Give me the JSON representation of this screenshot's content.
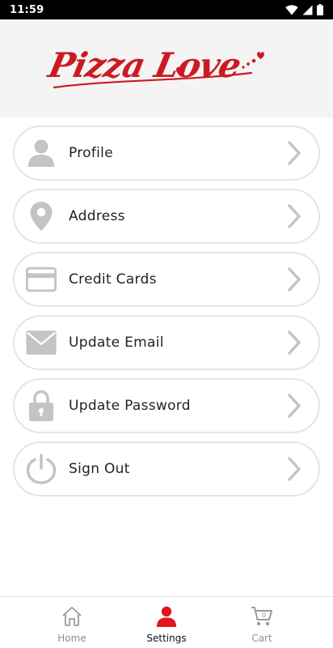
{
  "status_bar": {
    "time": "11:59"
  },
  "header": {
    "logo_text": "Pizza Love"
  },
  "menu": {
    "items": [
      {
        "label": "Profile",
        "icon": "person-icon"
      },
      {
        "label": "Address",
        "icon": "location-pin-icon"
      },
      {
        "label": "Credit Cards",
        "icon": "credit-card-icon"
      },
      {
        "label": "Update Email",
        "icon": "envelope-icon"
      },
      {
        "label": "Update Password",
        "icon": "padlock-icon"
      },
      {
        "label": "Sign Out",
        "icon": "power-icon"
      }
    ]
  },
  "bottom_nav": {
    "items": [
      {
        "label": "Home",
        "icon": "home-icon",
        "active": false
      },
      {
        "label": "Settings",
        "icon": "person-icon",
        "active": true
      },
      {
        "label": "Cart",
        "icon": "cart-icon",
        "active": false,
        "badge": "0"
      }
    ]
  },
  "colors": {
    "brand_red": "#cc1a22",
    "active_red": "#e5141d",
    "icon_gray": "#c4c4c4",
    "border_gray": "#e4e4e4"
  }
}
